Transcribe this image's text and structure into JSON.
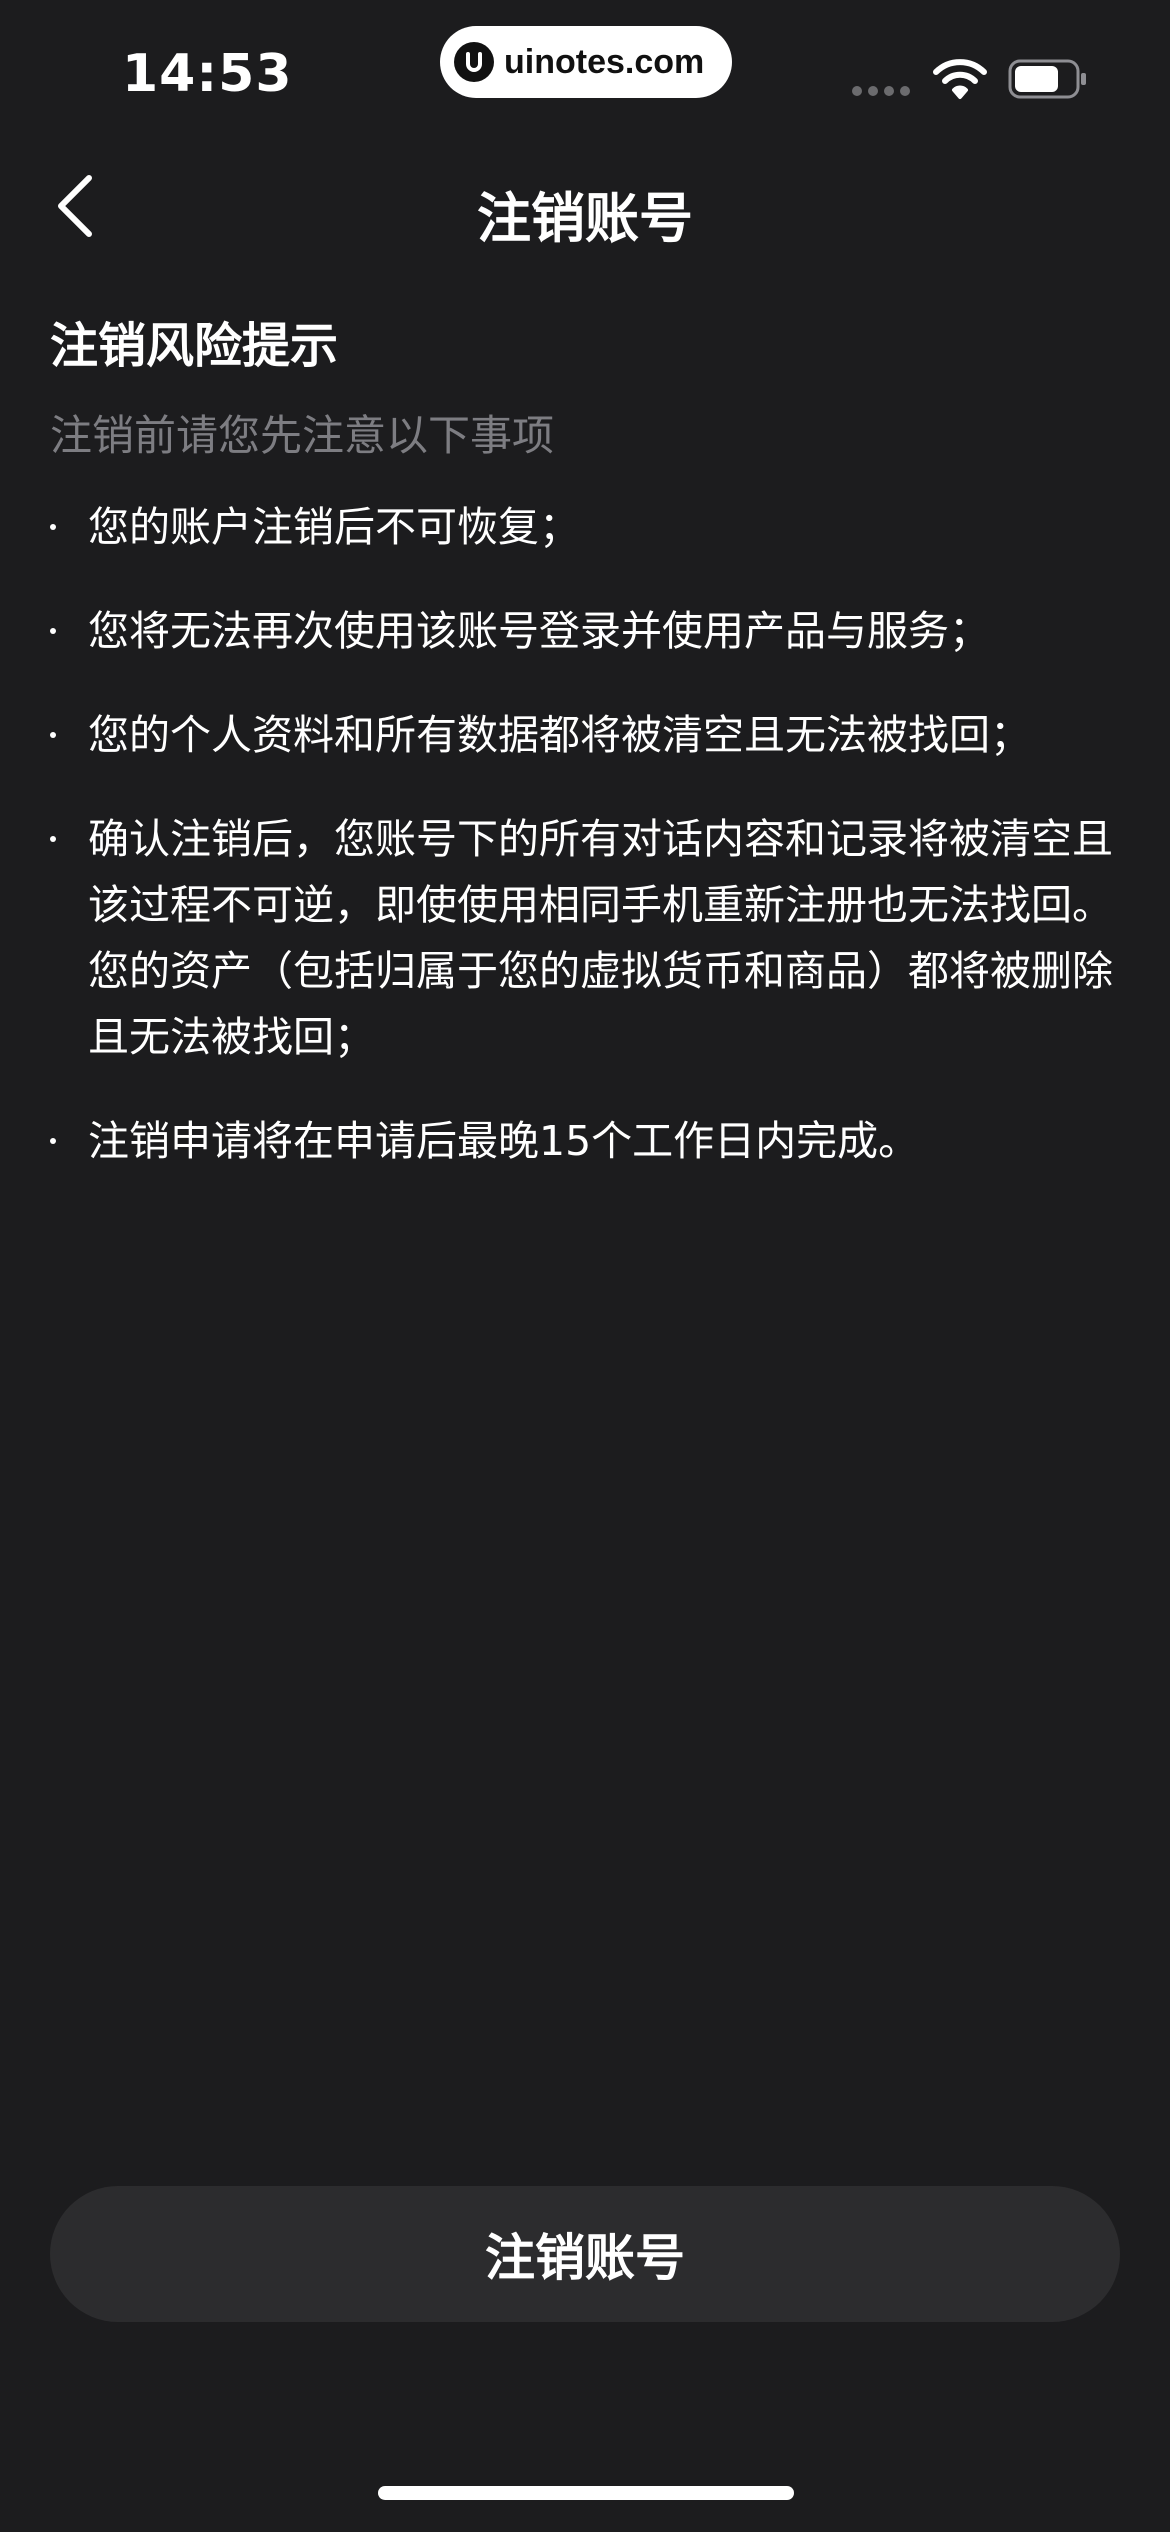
{
  "status_bar": {
    "time": "14:53",
    "watermark": "uinotes.com",
    "icons": [
      "signal-icon",
      "wifi-icon",
      "battery-icon"
    ]
  },
  "nav": {
    "back_icon": "chevron-left-icon",
    "title": "注销账号"
  },
  "content": {
    "section_title": "注销风险提示",
    "section_subtitle": "注销前请您先注意以下事项",
    "items": [
      "您的账户注销后不可恢复；",
      "您将无法再次使用该账号登录并使用产品与服务；",
      "您的个人资料和所有数据都将被清空且无法被找回；",
      "确认注销后，您账号下的所有对话内容和记录将被清空且该过程不可逆，即使使用相同手机重新注册也无法找回。您的资产（包括归属于您的虚拟货币和商品）都将被删除且无法被找回；",
      "注销申请将在申请后最晚15个工作日内完成。"
    ]
  },
  "footer": {
    "button_label": "注销账号"
  },
  "colors": {
    "background": "#1c1c1e",
    "button_background": "#2c2c2e",
    "subtitle_text": "#7d7d82",
    "text": "#ffffff"
  }
}
